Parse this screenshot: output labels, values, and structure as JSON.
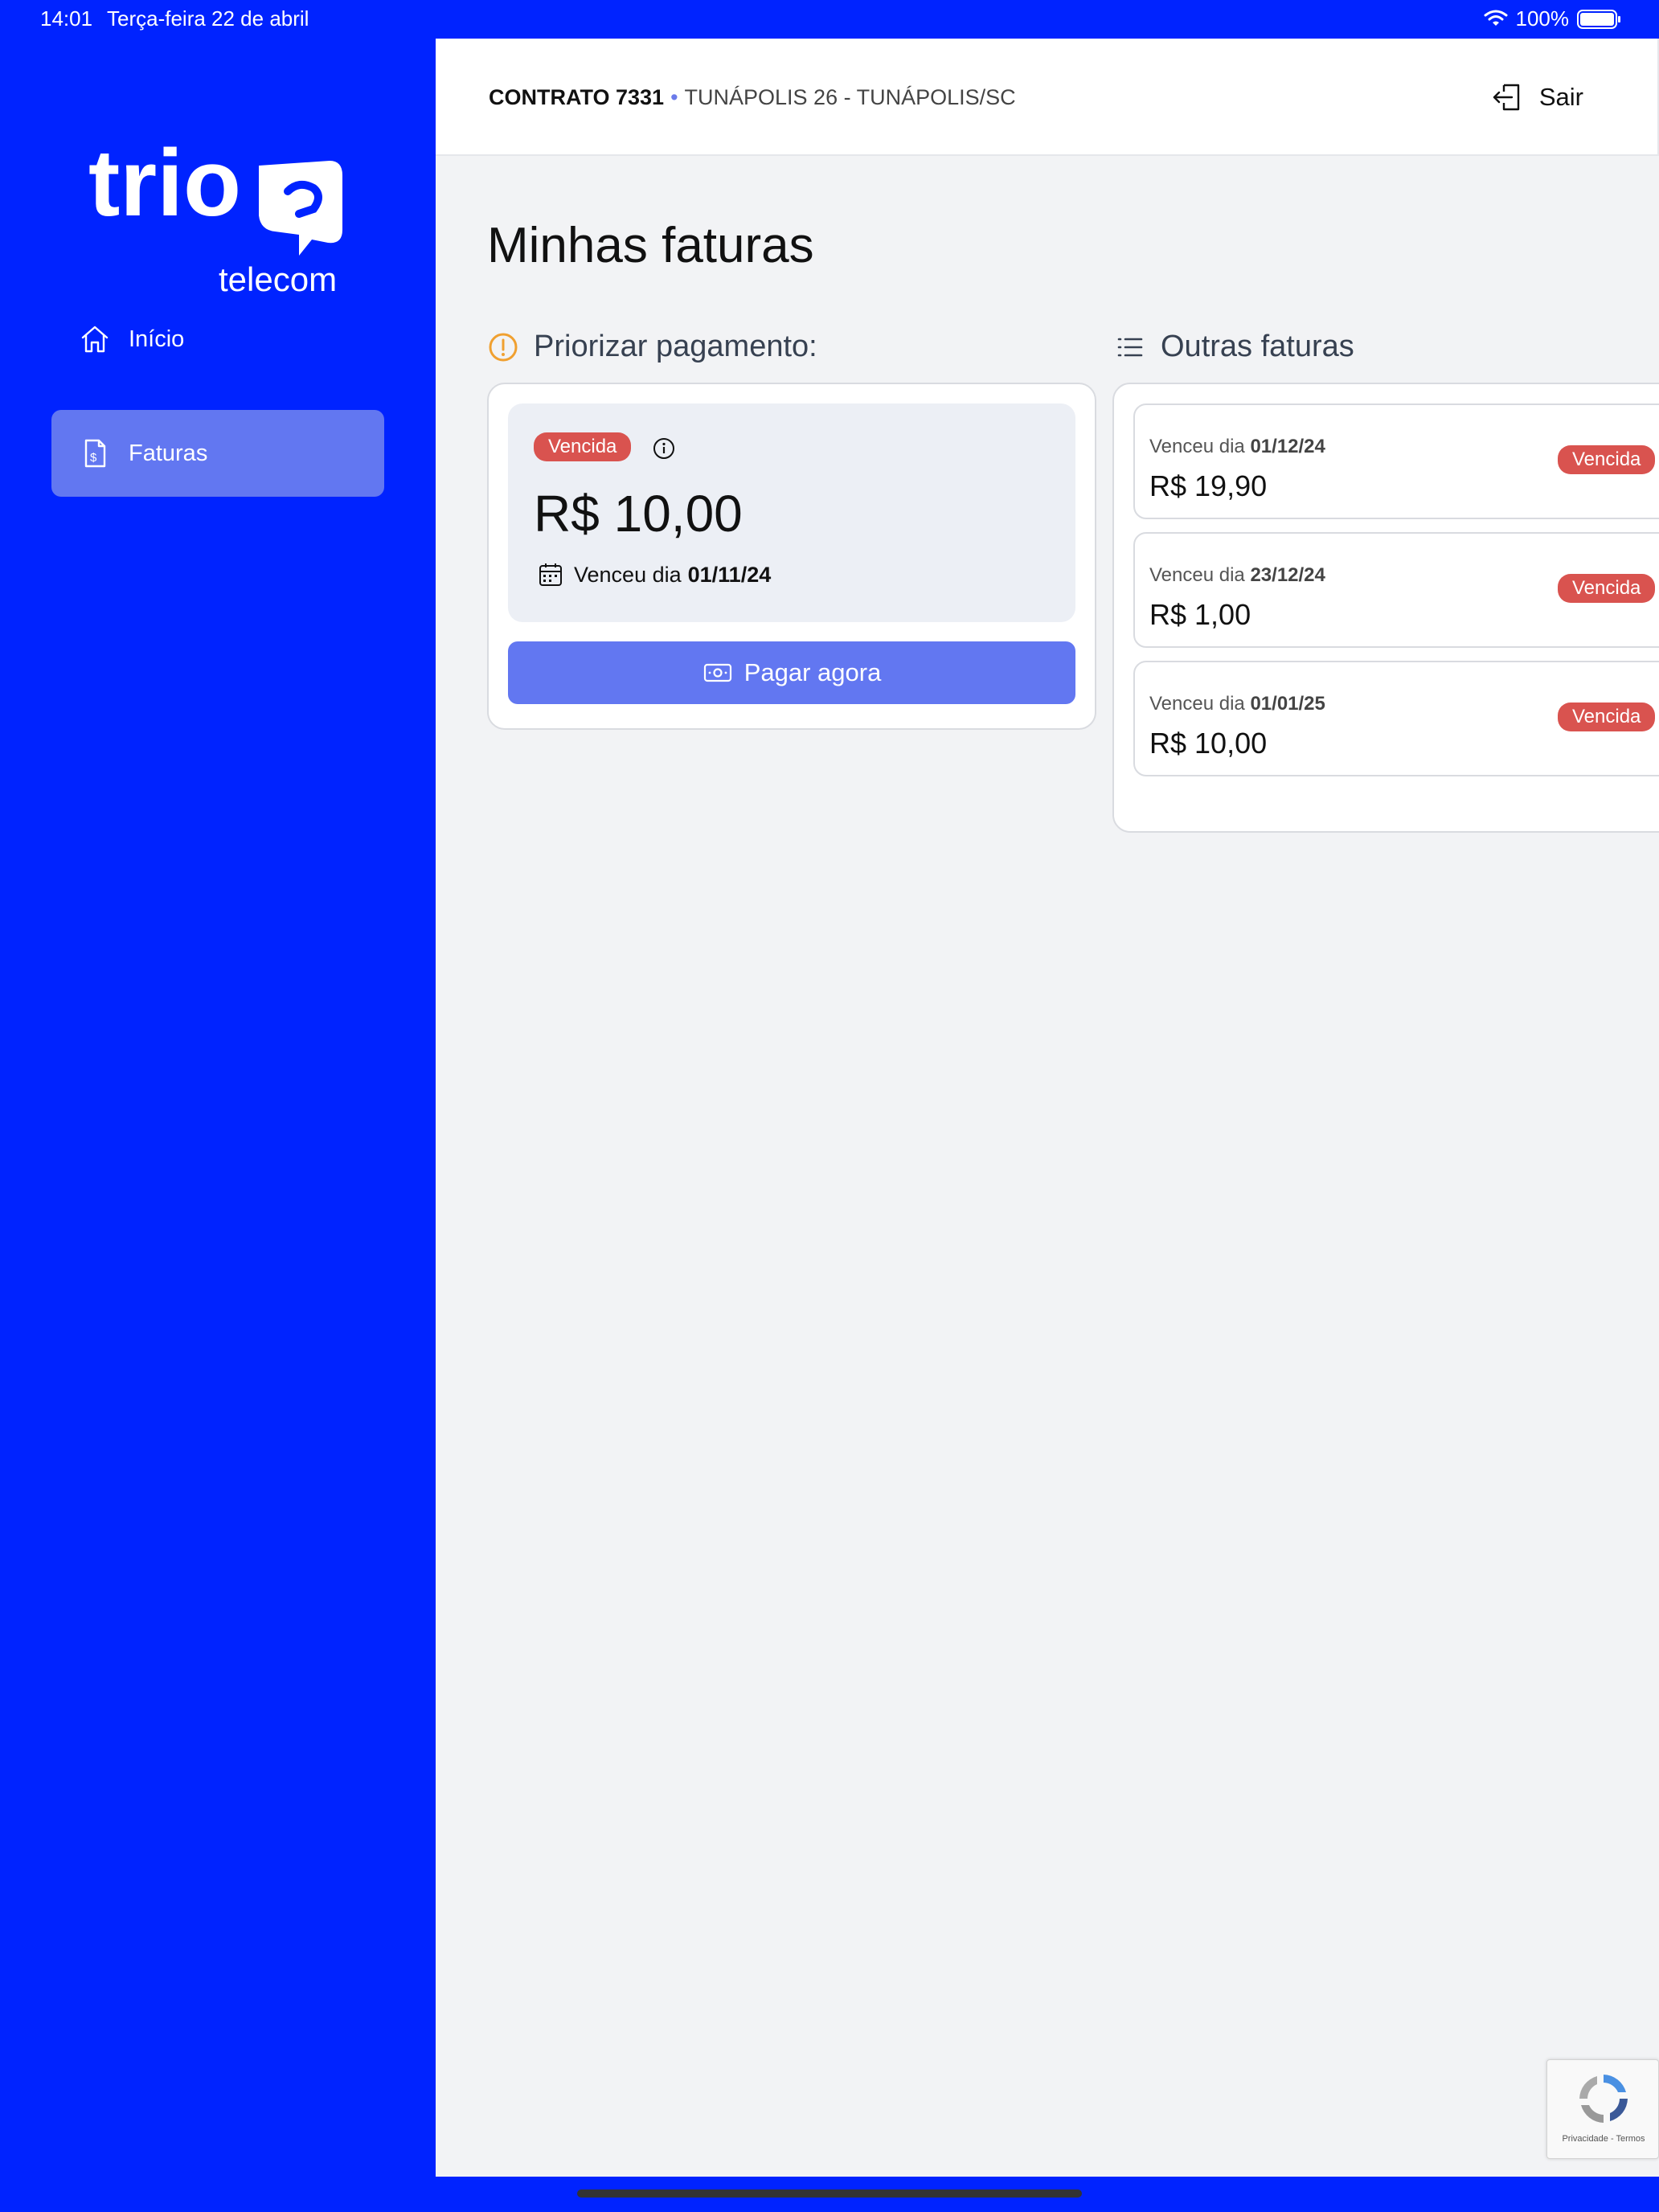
{
  "status_bar": {
    "time": "14:01",
    "date": "Terça-feira 22 de abril",
    "battery": "100%"
  },
  "brand": {
    "logo_text": "trio",
    "logo_sub": "telecom"
  },
  "sidebar": {
    "items": [
      {
        "label": "Início",
        "icon": "home-icon"
      },
      {
        "label": "Faturas",
        "icon": "invoice-icon",
        "active": true
      }
    ]
  },
  "header": {
    "contract_label": "CONTRATO 7331",
    "separator": "•",
    "address": "TUNÁPOLIS 26 - TUNÁPOLIS/SC",
    "logout_label": "Sair"
  },
  "page": {
    "title": "Minhas faturas"
  },
  "priority": {
    "heading": "Priorizar pagamento:",
    "status": "Vencida",
    "amount": "R$ 10,00",
    "due_prefix": "Venceu dia",
    "due_date": "01/11/24",
    "pay_button": "Pagar agora"
  },
  "others": {
    "heading": "Outras faturas",
    "invoices": [
      {
        "due_prefix": "Venceu dia",
        "due_date": "01/12/24",
        "amount": "R$ 19,90",
        "status": "Vencida"
      },
      {
        "due_prefix": "Venceu dia",
        "due_date": "23/12/24",
        "amount": "R$ 1,00",
        "status": "Vencida"
      },
      {
        "due_prefix": "Venceu dia",
        "due_date": "01/01/25",
        "amount": "R$ 10,00",
        "status": "Vencida"
      }
    ]
  },
  "recaptcha": {
    "text": "Privacidade - Termos"
  },
  "colors": {
    "brand_blue": "#0023ff",
    "accent": "#6277f1",
    "overdue": "#d9534f",
    "warning": "#f0a030"
  }
}
